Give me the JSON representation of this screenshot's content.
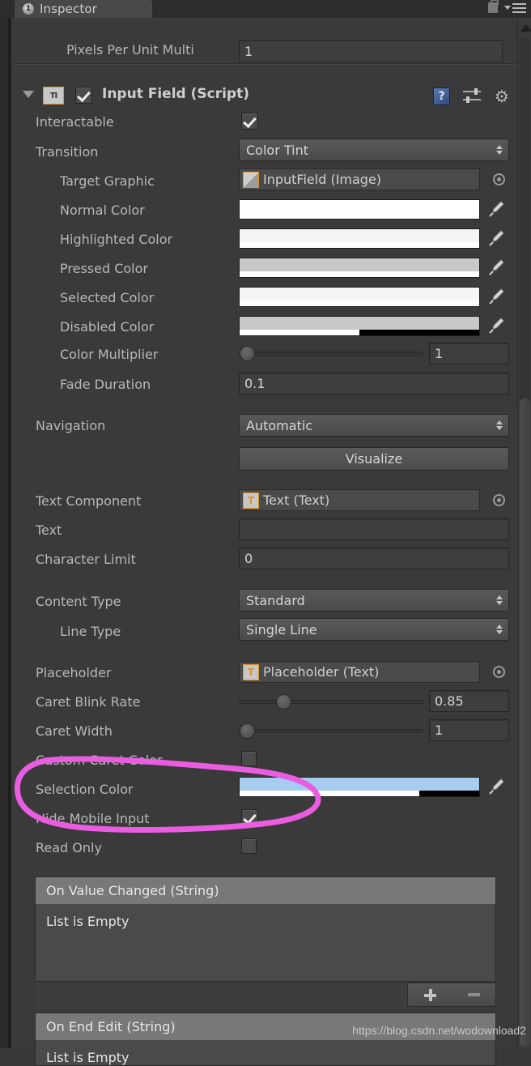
{
  "window": {
    "tab_label": "Inspector",
    "tab_badge": "1",
    "lock_icon": "lock-icon",
    "menu_icon": "hamburger-menu-icon"
  },
  "pixels_per_unit": {
    "label": "Pixels Per Unit Multi",
    "value": "1"
  },
  "component": {
    "title": "Input Field (Script)",
    "script_icon_glyph": "TI",
    "enabled": true,
    "foldout_open": true,
    "help_icon": "help-book-icon",
    "preset_icon": "preset-sliders-icon",
    "settings_icon": "gear-icon"
  },
  "fields": {
    "interactable": {
      "label": "Interactable",
      "checked": true
    },
    "transition": {
      "label": "Transition",
      "value": "Color Tint"
    },
    "target_graphic": {
      "label": "Target Graphic",
      "value": "InputField (Image)"
    },
    "normal_color": {
      "label": "Normal Color",
      "color": "#FFFFFF",
      "alpha_pct": 100
    },
    "highlighted_color": {
      "label": "Highlighted Color",
      "color": "#F5F5F5",
      "alpha_pct": 100
    },
    "pressed_color": {
      "label": "Pressed Color",
      "color": "#C8C8C8",
      "alpha_pct": 100
    },
    "selected_color": {
      "label": "Selected Color",
      "color": "#F5F5F5",
      "alpha_pct": 100
    },
    "disabled_color": {
      "label": "Disabled Color",
      "color": "#C8C8C8",
      "alpha_pct": 50
    },
    "color_multiplier": {
      "label": "Color Multiplier",
      "value": "1",
      "slider_pct": 1
    },
    "fade_duration": {
      "label": "Fade Duration",
      "value": "0.1"
    },
    "navigation": {
      "label": "Navigation",
      "value": "Automatic"
    },
    "visualize": {
      "label": "Visualize"
    },
    "text_component": {
      "label": "Text Component",
      "value": "Text (Text)"
    },
    "text": {
      "label": "Text",
      "value": ""
    },
    "character_limit": {
      "label": "Character Limit",
      "value": "0"
    },
    "content_type": {
      "label": "Content Type",
      "value": "Standard"
    },
    "line_type": {
      "label": "Line Type",
      "value": "Single Line"
    },
    "placeholder": {
      "label": "Placeholder",
      "value": "Placeholder (Text)"
    },
    "caret_blink_rate": {
      "label": "Caret Blink Rate",
      "value": "0.85",
      "slider_pct": 21
    },
    "caret_width": {
      "label": "Caret Width",
      "value": "1",
      "slider_pct": 1
    },
    "custom_caret_color": {
      "label": "Custom Caret Color",
      "checked": false
    },
    "selection_color": {
      "label": "Selection Color",
      "color": "#A8CBF0",
      "alpha_pct": 75
    },
    "hide_mobile_input": {
      "label": "Hide Mobile Input",
      "checked": true
    },
    "read_only": {
      "label": "Read Only",
      "checked": false
    }
  },
  "events": [
    {
      "header": "On Value Changed (String)",
      "empty_text": "List is Empty"
    },
    {
      "header": "On End Edit (String)",
      "empty_text": "List is Empty"
    }
  ],
  "list_controls": {
    "add_label": "+",
    "remove_label": "−"
  },
  "annotation": {
    "color": "#ea5ce0",
    "shape": "hand-drawn-ellipse"
  },
  "watermark": {
    "text": "https://blog.csdn.net/wodownload2"
  }
}
